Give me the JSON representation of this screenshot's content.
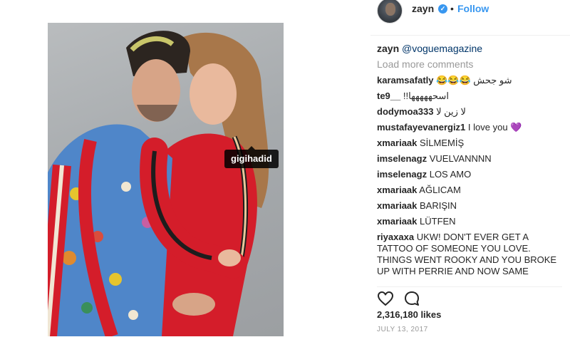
{
  "post": {
    "author": "zayn",
    "verified_glyph": "✓",
    "separator": "•",
    "follow_label": "Follow",
    "photo_tag": "gigihadid",
    "caption": {
      "user": "zayn",
      "mention": "@voguemagazine"
    },
    "load_more": "Load more comments",
    "comments": [
      {
        "user": "karamsafatly",
        "text": "😂😂😂 شو جحش"
      },
      {
        "user": "te9__",
        "text": "!!اسحههههها"
      },
      {
        "user": "dodymoa333",
        "text": "لا زين لا"
      },
      {
        "user": "mustafayevanergiz1",
        "text": "I love you 💜"
      },
      {
        "user": "xmariaak",
        "text": "SİLMEMİŞ"
      },
      {
        "user": "imselenagz",
        "text": "VUELVANNNN"
      },
      {
        "user": "imselenagz",
        "text": "LOS AMO"
      },
      {
        "user": "xmariaak",
        "text": "AĞLICAM"
      },
      {
        "user": "xmariaak",
        "text": "BARIŞIN"
      },
      {
        "user": "xmariaak",
        "text": "LÜTFEN"
      },
      {
        "user": "riyaxaxa",
        "text": "UKW! DON'T EVER GET A TATTOO OF SOMEONE YOU LOVE. THINGS WENT ROOKY AND YOU BROKE UP WITH PERRIE AND NOW SAME"
      }
    ],
    "likes": "2,316,180 likes",
    "date": "JULY 13, 2017",
    "icons": {
      "like": "heart-icon",
      "comment": "comment-icon"
    },
    "colors": {
      "link": "#3897f0",
      "mention": "#003569",
      "muted": "#999999"
    }
  }
}
